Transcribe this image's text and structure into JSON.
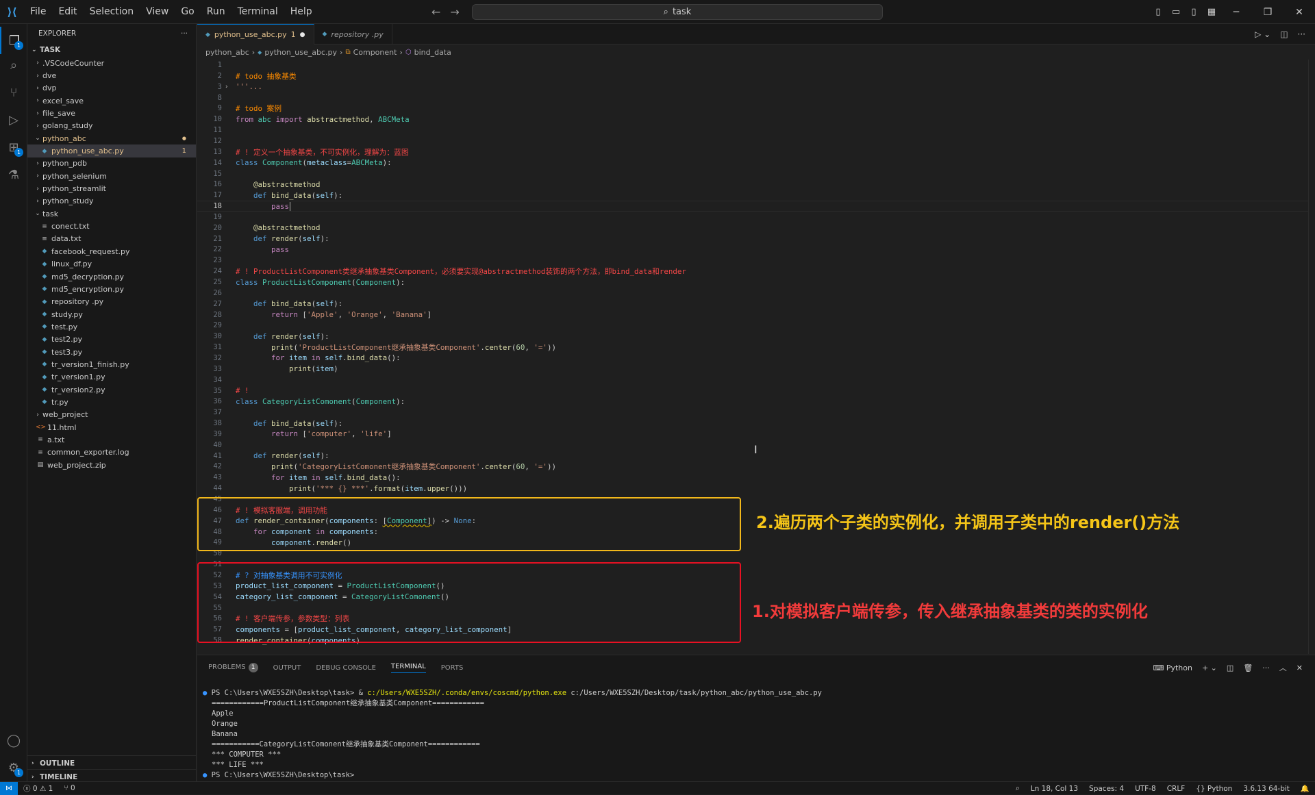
{
  "menu": [
    "File",
    "Edit",
    "Selection",
    "View",
    "Go",
    "Run",
    "Terminal",
    "Help"
  ],
  "search": {
    "text": "task"
  },
  "explorer": {
    "title": "EXPLORER",
    "root": "TASK",
    "items": [
      {
        "label": ".VSCodeCounter",
        "type": "folder",
        "depth": 1
      },
      {
        "label": "dve",
        "type": "folder",
        "depth": 1
      },
      {
        "label": "dvp",
        "type": "folder",
        "depth": 1
      },
      {
        "label": "excel_save",
        "type": "folder",
        "depth": 1
      },
      {
        "label": "file_save",
        "type": "folder",
        "depth": 1
      },
      {
        "label": "golang_study",
        "type": "folder",
        "depth": 1
      },
      {
        "label": "python_abc",
        "type": "folder-open",
        "depth": 1,
        "modified": true
      },
      {
        "label": "python_use_abc.py",
        "type": "py",
        "depth": 2,
        "selected": true,
        "count": "1"
      },
      {
        "label": "python_pdb",
        "type": "folder",
        "depth": 1
      },
      {
        "label": "python_selenium",
        "type": "folder",
        "depth": 1
      },
      {
        "label": "python_streamlit",
        "type": "folder",
        "depth": 1
      },
      {
        "label": "python_study",
        "type": "folder",
        "depth": 1
      },
      {
        "label": "task",
        "type": "folder-open",
        "depth": 1
      },
      {
        "label": "conect.txt",
        "type": "txt",
        "depth": 2
      },
      {
        "label": "data.txt",
        "type": "txt",
        "depth": 2
      },
      {
        "label": "facebook_request.py",
        "type": "py",
        "depth": 2
      },
      {
        "label": "linux_df.py",
        "type": "py",
        "depth": 2
      },
      {
        "label": "md5_decryption.py",
        "type": "py",
        "depth": 2
      },
      {
        "label": "md5_encryption.py",
        "type": "py",
        "depth": 2
      },
      {
        "label": "repository .py",
        "type": "py",
        "depth": 2
      },
      {
        "label": "study.py",
        "type": "py",
        "depth": 2
      },
      {
        "label": "test.py",
        "type": "py",
        "depth": 2
      },
      {
        "label": "test2.py",
        "type": "py",
        "depth": 2
      },
      {
        "label": "test3.py",
        "type": "py",
        "depth": 2
      },
      {
        "label": "tr_version1_finish.py",
        "type": "py",
        "depth": 2
      },
      {
        "label": "tr_version1.py",
        "type": "py",
        "depth": 2
      },
      {
        "label": "tr_version2.py",
        "type": "py",
        "depth": 2
      },
      {
        "label": "tr.py",
        "type": "py",
        "depth": 2
      },
      {
        "label": "web_project",
        "type": "folder",
        "depth": 1
      },
      {
        "label": "11.html",
        "type": "html",
        "depth": 1
      },
      {
        "label": "a.txt",
        "type": "txt",
        "depth": 1
      },
      {
        "label": "common_exporter.log",
        "type": "txt",
        "depth": 1
      },
      {
        "label": "web_project.zip",
        "type": "zip",
        "depth": 1
      }
    ],
    "outline": "OUTLINE",
    "timeline": "TIMELINE"
  },
  "tabs": [
    {
      "label": "python_use_abc.py",
      "suffix": "1",
      "dirty": "●"
    },
    {
      "label": "repository .py"
    }
  ],
  "breadcrumb": [
    "python_abc",
    "python_use_abc.py",
    "Component",
    "bind_data"
  ],
  "annotations": {
    "yellow": "2.遍历两个子类的实例化，并调用子类中的render()方法",
    "red": "1.对模拟客户端传参，传入继承抽象基类的类的实例化"
  },
  "panel": {
    "tabs": [
      "PROBLEMS",
      "OUTPUT",
      "DEBUG CONSOLE",
      "TERMINAL",
      "PORTS"
    ],
    "problems_count": "1",
    "active": "TERMINAL",
    "shell": "Python",
    "terminal": [
      {
        "prompt": "PS C:\\Users\\WXE5SZH\\Desktop\\task> & ",
        "cmd": "c:/Users/WXE5SZH/.conda/envs/coscmd/python.exe",
        "rest": " c:/Users/WXE5SZH/Desktop/task/python_abc/python_use_abc.py"
      },
      {
        "text": "============ProductListComponent继承抽象基类Component============"
      },
      {
        "text": "Apple"
      },
      {
        "text": "Orange"
      },
      {
        "text": "Banana"
      },
      {
        "text": "===========CategoryListComonent继承抽象基类Component============"
      },
      {
        "text": "*** COMPUTER ***"
      },
      {
        "text": "*** LIFE ***"
      },
      {
        "text": "PS C:\\Users\\WXE5SZH\\Desktop\\task> "
      }
    ]
  },
  "status": {
    "errors": "0",
    "warnings": "1",
    "ports": "0",
    "position": "Ln 18, Col 13",
    "spaces": "Spaces: 4",
    "encoding": "UTF-8",
    "eol": "CRLF",
    "language": "Python",
    "interpreter": "3.6.13 64-bit"
  },
  "code": [
    {
      "n": 1,
      "h": ""
    },
    {
      "n": 2,
      "h": "<span class='cmt-o'># todo 抽象基类</span>"
    },
    {
      "n": 3,
      "h": "<span class='str'>'''...</span>",
      "fold": true
    },
    {
      "n": 8,
      "h": ""
    },
    {
      "n": 9,
      "h": "<span class='cmt-o'># todo 案例</span>"
    },
    {
      "n": 10,
      "h": "<span class='kw2'>from</span> <span class='cls'>abc</span> <span class='kw2'>import</span> <span class='fn'>abstractmethod</span>, <span class='cls'>ABCMeta</span>"
    },
    {
      "n": 11,
      "h": ""
    },
    {
      "n": 12,
      "h": ""
    },
    {
      "n": 13,
      "h": "<span class='cmt-r'># ! 定义一个抽象基类，不可实例化，理解为：蓝图</span>"
    },
    {
      "n": 14,
      "h": "<span class='kw'>class</span> <span class='cls'>Component</span>(<span class='var'>metaclass</span>=<span class='cls'>ABCMeta</span>):"
    },
    {
      "n": 15,
      "h": ""
    },
    {
      "n": 16,
      "h": "    <span class='dec'>@abstractmethod</span>"
    },
    {
      "n": 17,
      "h": "    <span class='kw'>def</span> <span class='fn'>bind_data</span>(<span class='var'>self</span>):"
    },
    {
      "n": 18,
      "h": "        <span class='kw2'>pass</span>",
      "cur": true
    },
    {
      "n": 19,
      "h": ""
    },
    {
      "n": 20,
      "h": "    <span class='dec'>@abstractmethod</span>"
    },
    {
      "n": 21,
      "h": "    <span class='kw'>def</span> <span class='fn'>render</span>(<span class='var'>self</span>):"
    },
    {
      "n": 22,
      "h": "        <span class='kw2'>pass</span>"
    },
    {
      "n": 23,
      "h": ""
    },
    {
      "n": 24,
      "h": "<span class='cmt-r'># ! ProductListComponent类继承抽象基类Component，必须要实现@abstractmethod装饰的两个方法，即bind_data和render</span>"
    },
    {
      "n": 25,
      "h": "<span class='kw'>class</span> <span class='cls'>ProductListComponent</span>(<span class='cls'>Component</span>):"
    },
    {
      "n": 26,
      "h": ""
    },
    {
      "n": 27,
      "h": "    <span class='kw'>def</span> <span class='fn'>bind_data</span>(<span class='var'>self</span>):"
    },
    {
      "n": 28,
      "h": "        <span class='kw2'>return</span> [<span class='str'>'Apple'</span>, <span class='str'>'Orange'</span>, <span class='str'>'Banana'</span>]"
    },
    {
      "n": 29,
      "h": ""
    },
    {
      "n": 30,
      "h": "    <span class='kw'>def</span> <span class='fn'>render</span>(<span class='var'>self</span>):"
    },
    {
      "n": 31,
      "h": "        <span class='fn'>print</span>(<span class='str'>'ProductListComponent继承抽象基类Component'</span>.<span class='fn'>center</span>(<span class='num2'>60</span>, <span class='str'>'='</span>))"
    },
    {
      "n": 32,
      "h": "        <span class='kw2'>for</span> <span class='var'>item</span> <span class='kw2'>in</span> <span class='var'>self</span>.<span class='fn'>bind_data</span>():"
    },
    {
      "n": 33,
      "h": "            <span class='fn'>print</span>(<span class='var'>item</span>)"
    },
    {
      "n": 34,
      "h": ""
    },
    {
      "n": 35,
      "h": "<span class='cmt-r'># !</span>"
    },
    {
      "n": 36,
      "h": "<span class='kw'>class</span> <span class='cls'>CategoryListComonent</span>(<span class='cls'>Component</span>):"
    },
    {
      "n": 37,
      "h": ""
    },
    {
      "n": 38,
      "h": "    <span class='kw'>def</span> <span class='fn'>bind_data</span>(<span class='var'>self</span>):"
    },
    {
      "n": 39,
      "h": "        <span class='kw2'>return</span> [<span class='str'>'computer'</span>, <span class='str'>'life'</span>]"
    },
    {
      "n": 40,
      "h": ""
    },
    {
      "n": 41,
      "h": "    <span class='kw'>def</span> <span class='fn'>render</span>(<span class='var'>self</span>):"
    },
    {
      "n": 42,
      "h": "        <span class='fn'>print</span>(<span class='str'>'CategoryListComonent继承抽象基类Component'</span>.<span class='fn'>center</span>(<span class='num2'>60</span>, <span class='str'>'='</span>))"
    },
    {
      "n": 43,
      "h": "        <span class='kw2'>for</span> <span class='var'>item</span> <span class='kw2'>in</span> <span class='var'>self</span>.<span class='fn'>bind_data</span>():"
    },
    {
      "n": 44,
      "h": "            <span class='fn'>print</span>(<span class='str'>'*** {} ***'</span>.<span class='fn'>format</span>(<span class='var'>item</span>.<span class='fn'>upper</span>()))"
    },
    {
      "n": 45,
      "h": ""
    },
    {
      "n": 46,
      "h": "<span class='cmt-r'># ! 模拟客服端，调用功能</span>"
    },
    {
      "n": 47,
      "h": "<span class='kw'>def</span> <span class='fn'>render_container</span>(<span class='var'>components</span>: <span class='sq'>[<span class='cls'>Component</span>]</span>) -> <span class='kw'>None</span>:"
    },
    {
      "n": 48,
      "h": "    <span class='kw2'>for</span> <span class='var'>component</span> <span class='kw2'>in</span> <span class='var'>components</span>:"
    },
    {
      "n": 49,
      "h": "        <span class='var'>component</span>.<span class='fn'>render</span>()"
    },
    {
      "n": 50,
      "h": ""
    },
    {
      "n": 51,
      "h": ""
    },
    {
      "n": 52,
      "h": "<span class='cmt-b'># ? 对抽象基类调用不可实例化</span>"
    },
    {
      "n": 53,
      "h": "<span class='var'>product_list_component</span> = <span class='cls'>ProductListComponent</span>()"
    },
    {
      "n": 54,
      "h": "<span class='var'>category_list_component</span> = <span class='cls'>CategoryListComonent</span>()"
    },
    {
      "n": 55,
      "h": ""
    },
    {
      "n": 56,
      "h": "<span class='cmt-r'># ! 客户端传参，参数类型：列表</span>"
    },
    {
      "n": 57,
      "h": "<span class='var'>components</span> = [<span class='var'>product_list_component</span>, <span class='var'>category_list_component</span>]"
    },
    {
      "n": 58,
      "h": "<span class='fn'>render_container</span>(<span class='var'>components</span>)"
    }
  ]
}
